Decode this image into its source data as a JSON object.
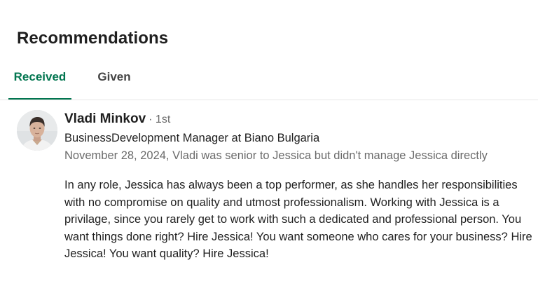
{
  "section": {
    "title": "Recommendations"
  },
  "tabs": [
    {
      "label": "Received",
      "active": true
    },
    {
      "label": "Given",
      "active": false
    }
  ],
  "recommendation": {
    "author_name": "Vladi Minkov",
    "connection_degree": "· 1st",
    "headline": "BusinessDevelopment Manager at Biano Bulgaria",
    "meta": "November 28, 2024, Vladi was senior to Jessica but didn't manage Jessica directly",
    "text": "In any role, Jessica has always been a top performer, as she handles her responsibilities with no compromise on quality and utmost professionalism. Working with Jessica is a privilage, since you rarely get to work with such a dedicated and professional person. You want things done right? Hire Jessica! You want someone who cares for your business? Hire Jessica! You want quality? Hire Jessica!"
  },
  "colors": {
    "accent": "#01754f",
    "text_primary": "#1f1f1f",
    "text_secondary": "#6b6b6b",
    "divider": "#e6e6e6"
  }
}
